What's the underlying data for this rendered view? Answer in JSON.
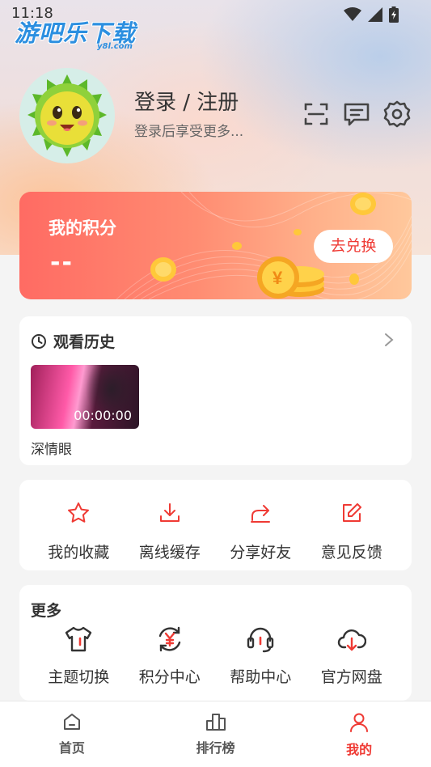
{
  "status_bar": {
    "time": "11:18"
  },
  "watermark": {
    "brand": "游吧乐下载",
    "domain": "y8l.com"
  },
  "profile": {
    "login_title": "登录 / 注册",
    "login_subtitle": "登录后享受更多..."
  },
  "header_icons": [
    "scan-icon",
    "message-icon",
    "settings-icon"
  ],
  "points": {
    "title": "我的积分",
    "value": "--",
    "redeem_label": "去兑换"
  },
  "history": {
    "title": "观看历史",
    "items": [
      {
        "duration": "00:00:00",
        "title": "深情眼"
      }
    ]
  },
  "quick_actions": [
    {
      "label": "我的收藏",
      "icon": "star-icon"
    },
    {
      "label": "离线缓存",
      "icon": "download-icon"
    },
    {
      "label": "分享好友",
      "icon": "share-icon"
    },
    {
      "label": "意见反馈",
      "icon": "feedback-icon"
    }
  ],
  "more": {
    "title": "更多",
    "items": [
      {
        "label": "主题切换",
        "icon": "tshirt-icon"
      },
      {
        "label": "积分中心",
        "icon": "yen-refresh-icon"
      },
      {
        "label": "帮助中心",
        "icon": "headset-icon"
      },
      {
        "label": "官方网盘",
        "icon": "cloud-download-icon"
      }
    ]
  },
  "bottom_nav": [
    {
      "label": "首页",
      "icon": "home-icon",
      "active": false
    },
    {
      "label": "排行榜",
      "icon": "ranking-icon",
      "active": false
    },
    {
      "label": "我的",
      "icon": "profile-icon",
      "active": true
    }
  ],
  "colors": {
    "accent": "#ef3a34",
    "text": "#333333",
    "background": "#f4f4f4"
  }
}
